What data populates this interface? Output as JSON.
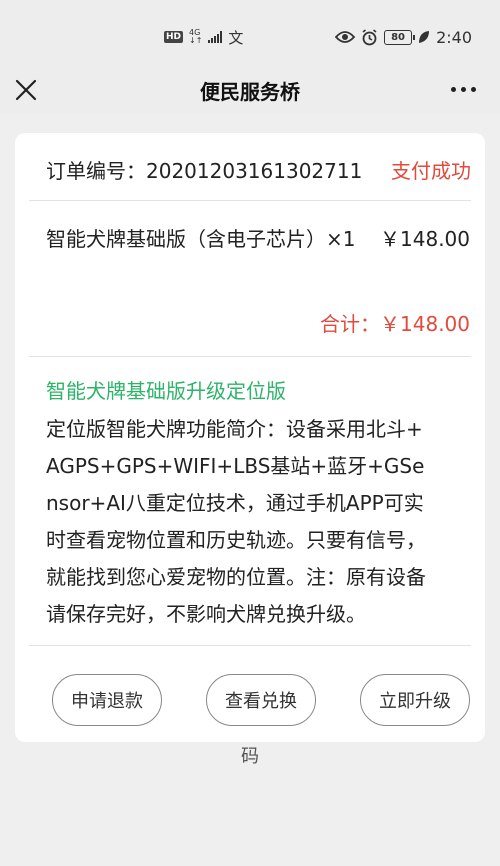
{
  "status_bar": {
    "hd": "HD",
    "net_top": "4G",
    "net_bottom": "↓↑",
    "extra_glyph": "文",
    "battery": "80",
    "time": "2:40"
  },
  "nav": {
    "title": "便民服务桥",
    "close_icon": "close-icon",
    "more_icon": "more-icon"
  },
  "order": {
    "number_label": "订单编号：20201203161302711",
    "status": "支付成功"
  },
  "product": {
    "name": "智能犬牌基础版（含电子芯片）×1",
    "price": "￥148.00"
  },
  "total": "合计：￥148.00",
  "upgrade": {
    "title": "智能犬牌基础版升级定位版",
    "description": "定位版智能犬牌功能简介：设备采用北斗+AGPS+GPS+WIFI+LBS基站+蓝牙+GSensor+AI八重定位技术，通过手机APP可实时查看宠物位置和历史轨迹。只要有信号，就能找到您心爱宠物的位置。注：原有设备请保存完好，不影响犬牌兑换升级。"
  },
  "buttons": {
    "refund": "申请退款",
    "view_exchange": "查看兑换",
    "upgrade_now": "立即升级"
  },
  "trailing_text": "码",
  "colors": {
    "accent_red": "#e04b3c",
    "accent_green": "#2db46a",
    "background": "#efefef"
  }
}
